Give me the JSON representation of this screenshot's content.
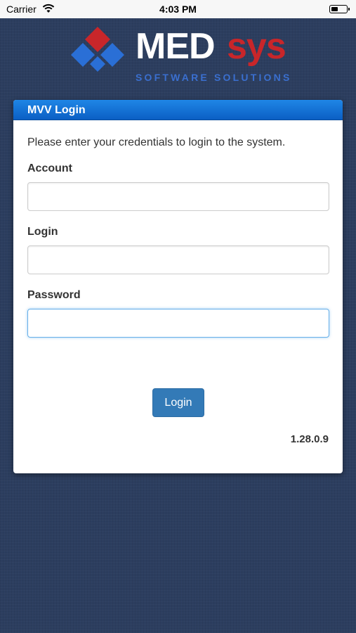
{
  "status_bar": {
    "carrier": "Carrier",
    "time": "4:03 PM",
    "wifi_icon": "wifi-icon",
    "battery_icon": "battery-icon"
  },
  "logo": {
    "name_part1": "MED",
    "name_part2": "sys",
    "tagline": "SOFTWARE SOLUTIONS",
    "colors": {
      "blue": "#2a6fd6",
      "red": "#c8262a"
    }
  },
  "panel": {
    "title": "MVV Login",
    "intro": "Please enter your credentials to login to the system.",
    "fields": [
      {
        "label": "Account",
        "value": "",
        "placeholder": ""
      },
      {
        "label": "Login",
        "value": "",
        "placeholder": ""
      },
      {
        "label": "Password",
        "value": "",
        "placeholder": ""
      }
    ],
    "login_button": "Login",
    "version": "1.28.0.9"
  },
  "colors": {
    "header_blue": "#0b6fd6",
    "button_blue": "#337ab7",
    "background": "#2c3e5f"
  }
}
